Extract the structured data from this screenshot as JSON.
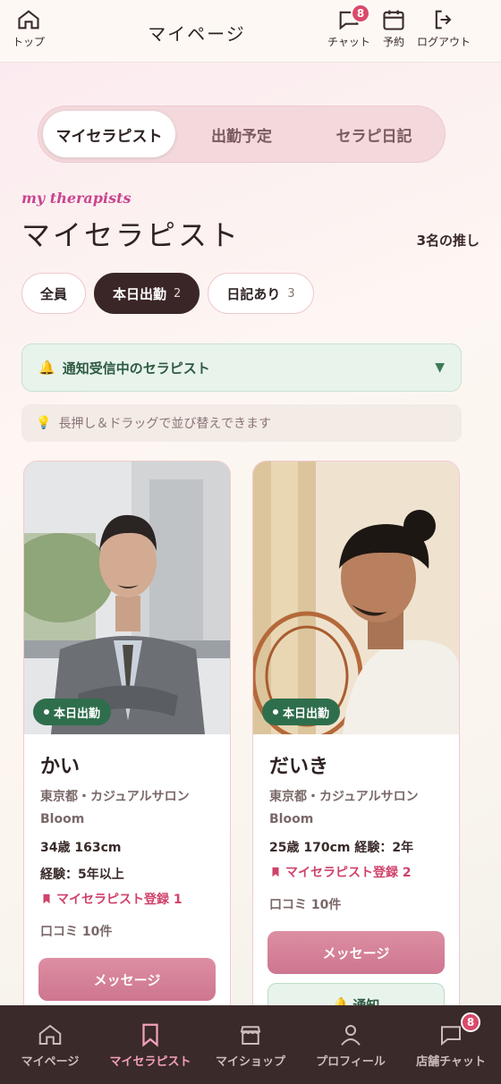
{
  "header": {
    "title": "マイページ",
    "top_label": "トップ",
    "chat_label": "チャット",
    "chat_badge": "8",
    "reserve_label": "予約",
    "logout_label": "ログアウト"
  },
  "tabs": [
    {
      "label": "マイセラピスト"
    },
    {
      "label": "出勤予定"
    },
    {
      "label": "セラピ日記"
    }
  ],
  "section": {
    "subtitle": "my therapists",
    "title": "マイセラピスト",
    "count": "3名の推し"
  },
  "filters": [
    {
      "label": "全員",
      "count": ""
    },
    {
      "label": "本日出勤",
      "count": "2"
    },
    {
      "label": "日記あり",
      "count": "3"
    }
  ],
  "notify_bar": {
    "label": "通知受信中のセラピスト"
  },
  "hint": {
    "text": "長押し＆ドラッグで並び替えできます"
  },
  "cards": [
    {
      "duty": "本日出勤",
      "name": "かい",
      "location": "東京都・カジュアルサロン Bloom",
      "age_height": "34歳  163cm",
      "experience": "経験：5年以上",
      "registered": "マイセラピスト登録 1",
      "reviews": "口コミ 10件",
      "message_label": "メッセージ"
    },
    {
      "duty": "本日出勤",
      "name": "だいき",
      "location": "東京都・カジュアルサロン Bloom",
      "age_height": "25歳  170cm  経験：2年",
      "registered": "マイセラピスト登録 2",
      "reviews": "口コミ 10件",
      "message_label": "メッセージ",
      "notify_label": "通知"
    }
  ],
  "bottom_nav": [
    {
      "label": "マイページ"
    },
    {
      "label": "マイセラピスト"
    },
    {
      "label": "マイショップ"
    },
    {
      "label": "プロフィール"
    },
    {
      "label": "店舗チャット",
      "badge": "8"
    }
  ],
  "colors": {
    "accent": "#d94a6b",
    "active_chip": "#3a2626",
    "duty": "#2f6e4c",
    "bottom_bar": "#3a2a2a"
  }
}
